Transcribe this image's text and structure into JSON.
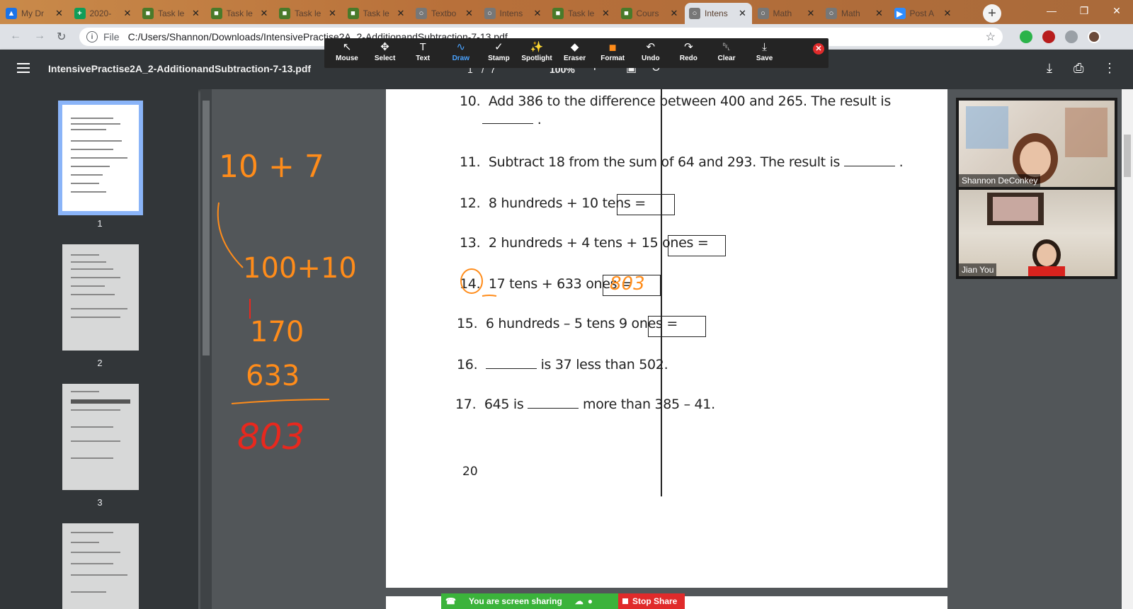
{
  "browser": {
    "tabs": [
      {
        "label": "My Dr",
        "icon": "drive-icon",
        "color": "#1a73e8"
      },
      {
        "label": "2020-",
        "icon": "sheets-icon",
        "color": "#0f9d58"
      },
      {
        "label": "Task le",
        "icon": "doc-icon",
        "color": "#4a7a2a"
      },
      {
        "label": "Task le",
        "icon": "doc-icon",
        "color": "#4a7a2a"
      },
      {
        "label": "Task le",
        "icon": "doc-icon",
        "color": "#4a7a2a"
      },
      {
        "label": "Task le",
        "icon": "doc-icon",
        "color": "#4a7a2a"
      },
      {
        "label": "Textbo",
        "icon": "globe-icon",
        "color": "#777"
      },
      {
        "label": "Intens",
        "icon": "globe-icon",
        "color": "#777"
      },
      {
        "label": "Task le",
        "icon": "doc-icon",
        "color": "#4a7a2a"
      },
      {
        "label": "Cours",
        "icon": "doc-icon",
        "color": "#4a7a2a"
      },
      {
        "label": "Intens",
        "icon": "globe-icon",
        "color": "#777",
        "active": true
      },
      {
        "label": "Math",
        "icon": "globe-icon",
        "color": "#777"
      },
      {
        "label": "Math",
        "icon": "globe-icon",
        "color": "#777"
      },
      {
        "label": "Post A",
        "icon": "zoom-icon",
        "color": "#2d8cff"
      }
    ],
    "address": {
      "scheme_label": "File",
      "url": "C:/Users/Shannon/Downloads/IntensivePractise2A_2-AdditionandSubtraction-7-13.pdf"
    }
  },
  "pdf": {
    "title": "IntensivePractise2A_2-AdditionandSubtraction-7-13.pdf",
    "page_current": "1",
    "page_sep": "/",
    "page_total": "7",
    "zoom": "100%",
    "thumbnails": [
      "1",
      "2",
      "3"
    ]
  },
  "annotate_toolbar": {
    "tools": [
      {
        "label": "Mouse",
        "icon": "cursor-icon"
      },
      {
        "label": "Select",
        "icon": "move-icon"
      },
      {
        "label": "Text",
        "icon": "text-icon"
      },
      {
        "label": "Draw",
        "icon": "draw-icon",
        "active": true
      },
      {
        "label": "Stamp",
        "icon": "check-icon"
      },
      {
        "label": "Spotlight",
        "icon": "wand-icon"
      },
      {
        "label": "Eraser",
        "icon": "eraser-icon"
      },
      {
        "label": "Format",
        "icon": "format-icon"
      },
      {
        "label": "Undo",
        "icon": "undo-icon"
      },
      {
        "label": "Redo",
        "icon": "redo-icon"
      },
      {
        "label": "Clear",
        "icon": "trash-icon"
      },
      {
        "label": "Save",
        "icon": "save-icon"
      }
    ],
    "format_color": "#ff8c1a"
  },
  "document": {
    "q10_num": "10.",
    "q10_text": "Add 386 to the difference between 400 and 265. The result is",
    "q10_tail": ".",
    "q11_num": "11.",
    "q11_text": "Subtract 18 from the sum of 64 and 293. The result is",
    "q11_tail": ".",
    "q12_num": "12.",
    "q12_text": "8 hundreds + 10 tens =",
    "q13_num": "13.",
    "q13_text": "2 hundreds + 4 tens + 15 ones =",
    "q14_num": "14.",
    "q14_text": "17 tens + 633 ones =",
    "q14_answer": "803",
    "q15_num": "15.",
    "q15_text": "6 hundreds – 5 tens 9 ones =",
    "q16_num": "16.",
    "q16_text": "is 37 less than 502.",
    "q17_num": "17.",
    "q17_pre": "645 is",
    "q17_post": "more than 385 – 41.",
    "page_number": "20"
  },
  "whiteboard_ink": {
    "line1": "10 + 7",
    "line2": "100+10",
    "line3": "170",
    "line4": "633",
    "line5": "803",
    "ink_orange": "#ff8c1a",
    "ink_red": "#e8281e"
  },
  "video": {
    "participant1": "Shannon DeConkey",
    "participant2": "Jian You"
  },
  "share": {
    "status": "You are screen sharing",
    "stop_label": "Stop Share"
  }
}
